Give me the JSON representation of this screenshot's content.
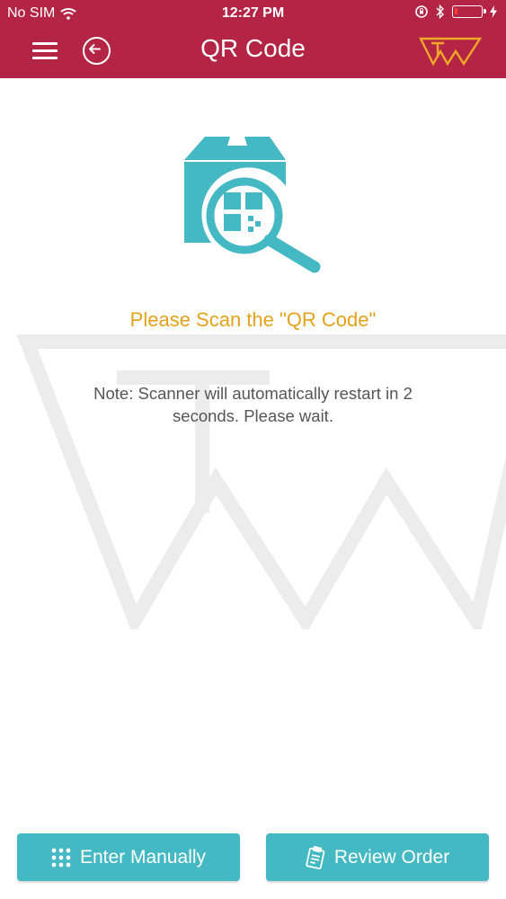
{
  "status_bar": {
    "carrier": "No SIM",
    "time": "12:27 PM"
  },
  "header": {
    "title": "QR Code",
    "background_color": "#b42444",
    "logo_color": "#f0a829"
  },
  "content": {
    "scan_prompt": "Please Scan the \"QR Code\"",
    "note": "Note: Scanner will automatically restart in 2 seconds. Please wait.",
    "accent_color": "#44b8c3",
    "prompt_color": "#e3a21a"
  },
  "footer": {
    "enter_manually_label": "Enter Manually",
    "review_order_label": "Review Order"
  },
  "icons": {
    "wifi": "wifi-icon",
    "orientation_lock": "orientation-lock-icon",
    "bluetooth": "bluetooth-icon",
    "battery": "battery-icon",
    "charging": "charging-bolt-icon",
    "menu": "hamburger-menu-icon",
    "back": "back-arrow-circle-icon",
    "logo": "brand-logo-icon",
    "hero": "box-qr-search-icon",
    "keypad": "keypad-icon",
    "clipboard": "clipboard-icon"
  }
}
